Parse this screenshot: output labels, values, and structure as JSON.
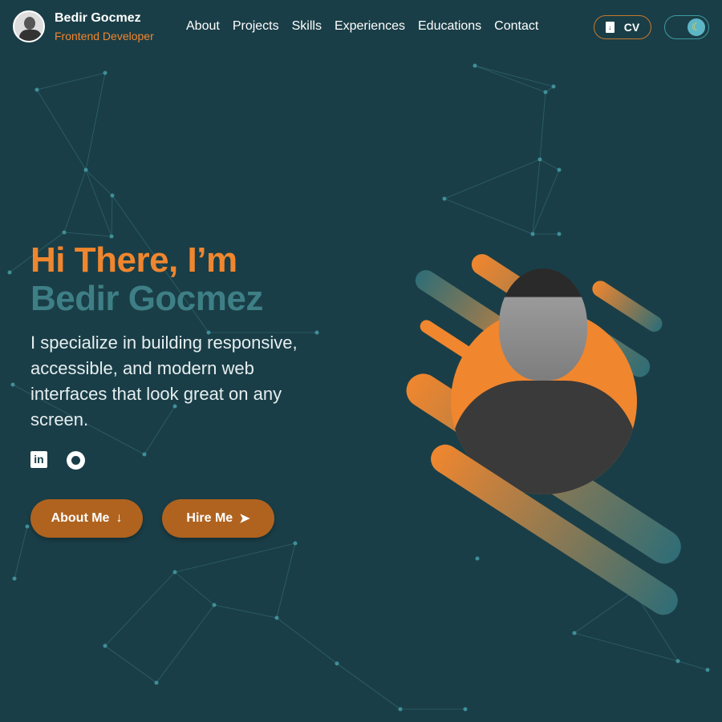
{
  "header": {
    "name": "Bedir Gocmez",
    "role": "Frontend Developer",
    "nav": [
      "About",
      "Projects",
      "Skills",
      "Experiences",
      "Educations",
      "Contact"
    ],
    "cv_label": "CV",
    "theme_icon": "moon-icon"
  },
  "hero": {
    "greeting": "Hi There, I’m",
    "name": "Bedir Gocmez",
    "description": "I specialize in building responsive, accessible, and modern web interfaces that look great on any screen.",
    "social": [
      "linkedin-icon",
      "github-icon"
    ],
    "about_button": "About Me",
    "hire_button": "Hire Me"
  },
  "colors": {
    "background": "#1a3e47",
    "accent": "#f0862e",
    "teal": "#3e7f86",
    "button": "#b0631f"
  }
}
